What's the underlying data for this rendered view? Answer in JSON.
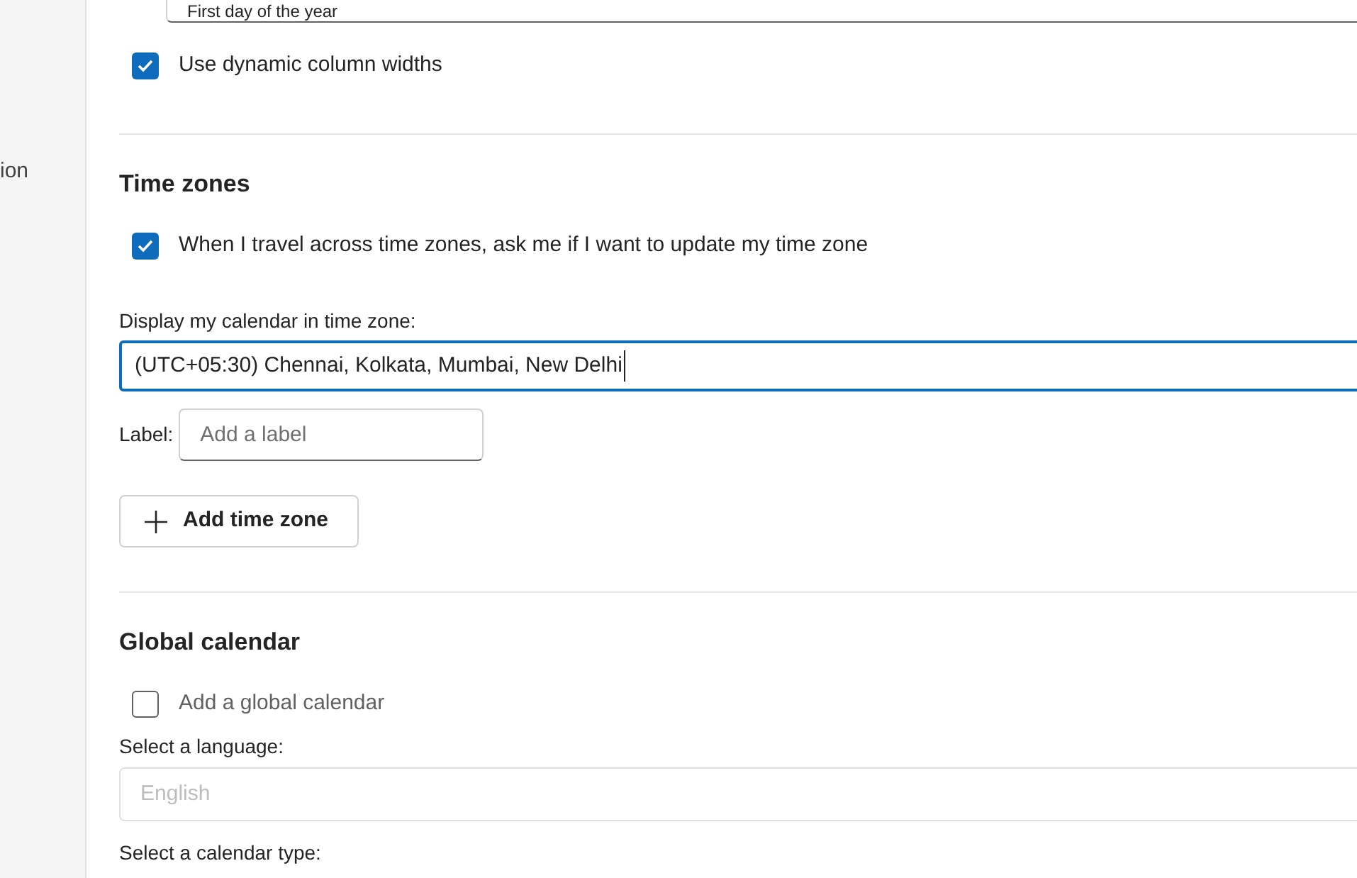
{
  "sidebar": {
    "items": [
      {
        "label": "ion",
        "selected": false
      }
    ]
  },
  "top_field": {
    "value": "First day of the year"
  },
  "dynamic_widths": {
    "label": "Use dynamic column widths",
    "checked": true
  },
  "sections": [
    {
      "kind": "timezones",
      "title": "Time zones",
      "ask_update": {
        "label": "When I travel across time zones, ask me if I want to update my time zone",
        "checked": true
      },
      "zone_label": "Display my calendar in time zone:",
      "zone_value": "(UTC+05:30) Chennai, Kolkata, Mumbai, New Delhi",
      "label_caption": "Label:",
      "label_placeholder": "Add a label",
      "add_button": "Add time zone"
    },
    {
      "kind": "global",
      "title": "Global calendar",
      "add_global": {
        "label": "Add a global calendar",
        "checked": false
      },
      "language_label": "Select a language:",
      "language_value": "English",
      "language_disabled": true,
      "type_label": "Select a calendar type:"
    }
  ]
}
